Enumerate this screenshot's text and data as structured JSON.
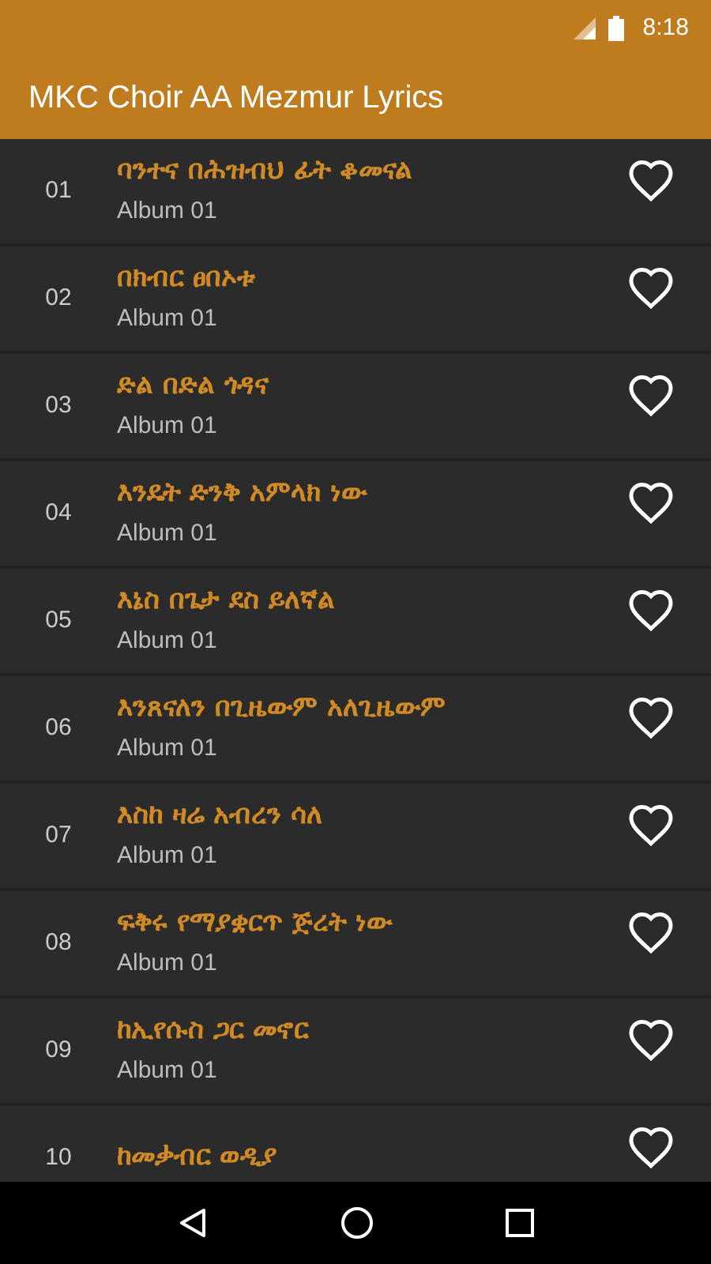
{
  "status_bar": {
    "time": "8:18"
  },
  "app_bar": {
    "title": "MKC Choir AA Mezmur Lyrics"
  },
  "songs": [
    {
      "number": "01",
      "title": "ባንተና በሕዝብህ ፊት ቆመናል",
      "album": "Album 01",
      "favorite": false
    },
    {
      "number": "02",
      "title": "በክብር ፀበኦቱ",
      "album": "Album 01",
      "favorite": false
    },
    {
      "number": "03",
      "title": "ድል በድል ጎዳና",
      "album": "Album 01",
      "favorite": false
    },
    {
      "number": "04",
      "title": "እንዴት ድንቅ አምላክ ነው",
      "album": "Album 01",
      "favorite": false
    },
    {
      "number": "05",
      "title": "እኔስ በጌታ ደስ ይለኛል",
      "album": "Album 01",
      "favorite": false
    },
    {
      "number": "06",
      "title": "እንጸናለን በጊዜውም አለጊዜውም",
      "album": "Album 01",
      "favorite": false
    },
    {
      "number": "07",
      "title": "እስከ ዛሬ አብረን ሳለ",
      "album": "Album 01",
      "favorite": false
    },
    {
      "number": "08",
      "title": "ፍቅሩ የማያቋርጥ ጅረት ነው",
      "album": "Album 01",
      "favorite": false
    },
    {
      "number": "09",
      "title": "ከኢየሱስ ጋር መኖር",
      "album": "Album 01",
      "favorite": false
    },
    {
      "number": "10",
      "title": "ከመቃብር ወዲያ",
      "favorite": false
    }
  ]
}
